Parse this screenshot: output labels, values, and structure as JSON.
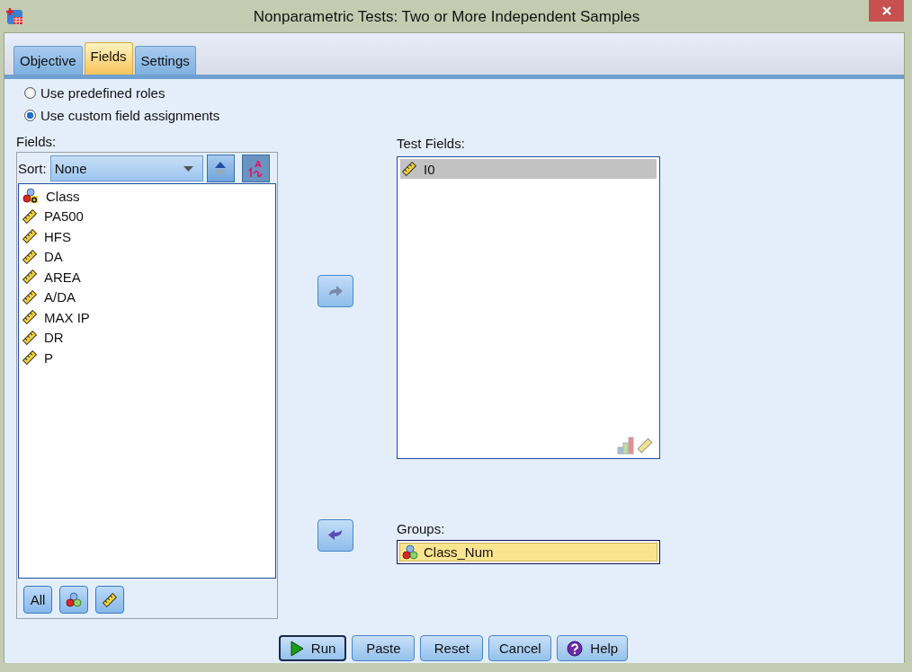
{
  "window": {
    "title": "Nonparametric Tests: Two or More Independent Samples"
  },
  "tabs": [
    {
      "label": "Objective",
      "selected": false
    },
    {
      "label": "Fields",
      "selected": true
    },
    {
      "label": "Settings",
      "selected": false
    }
  ],
  "role_options": [
    {
      "label": "Use predefined roles",
      "selected": false
    },
    {
      "label": "Use custom field assignments",
      "selected": true
    }
  ],
  "fields_panel": {
    "label": "Fields:",
    "sort_label": "Sort:",
    "sort_value": "None",
    "items": [
      {
        "name": "Class",
        "kind": "nominal_string"
      },
      {
        "name": "PA500",
        "kind": "scale"
      },
      {
        "name": "HFS",
        "kind": "scale"
      },
      {
        "name": "DA",
        "kind": "scale"
      },
      {
        "name": "AREA",
        "kind": "scale"
      },
      {
        "name": "A/DA",
        "kind": "scale"
      },
      {
        "name": "MAX IP",
        "kind": "scale"
      },
      {
        "name": "DR",
        "kind": "scale"
      },
      {
        "name": "P",
        "kind": "scale"
      }
    ],
    "filter_buttons": [
      {
        "kind": "text",
        "label": "All"
      },
      {
        "kind": "nominal"
      },
      {
        "kind": "scale"
      }
    ]
  },
  "test_fields": {
    "label": "Test Fields:",
    "items": [
      {
        "name": "I0",
        "kind": "scale",
        "selected": true
      }
    ]
  },
  "groups": {
    "label": "Groups:",
    "value": {
      "name": "Class_Num",
      "kind": "nominal"
    }
  },
  "buttons": [
    {
      "label": "Run",
      "kind": "run",
      "default": true
    },
    {
      "label": "Paste",
      "kind": "plain",
      "default": false
    },
    {
      "label": "Reset",
      "kind": "plain",
      "default": false
    },
    {
      "label": "Cancel",
      "kind": "plain",
      "default": false
    },
    {
      "label": "Help",
      "kind": "help",
      "default": false
    }
  ]
}
